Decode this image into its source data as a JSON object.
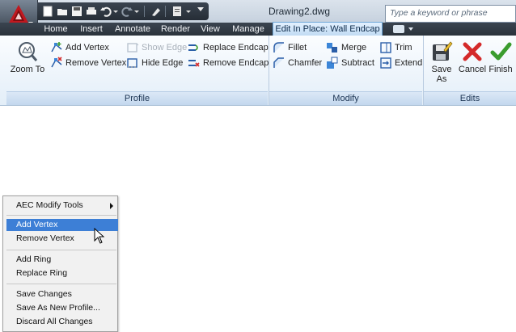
{
  "window": {
    "document_title": "Drawing2.dwg",
    "search_placeholder": "Type a keyword or phrase"
  },
  "tabs": [
    "Home",
    "Insert",
    "Annotate",
    "Render",
    "View",
    "Manage",
    "Edit In Place: Wall Endcap"
  ],
  "active_tab": "Edit In Place: Wall Endcap",
  "ribbon": {
    "profile": {
      "title": "Profile",
      "zoom_to": "Zoom To",
      "add_vertex": "Add Vertex",
      "remove_vertex": "Remove Vertex",
      "show_edge": "Show Edge",
      "hide_edge": "Hide Edge",
      "replace_endcap": "Replace Endcap",
      "remove_endcap": "Remove Endcap"
    },
    "modify": {
      "title": "Modify",
      "fillet": "Fillet",
      "chamfer": "Chamfer",
      "merge": "Merge",
      "subtract": "Subtract",
      "trim": "Trim",
      "extend": "Extend"
    },
    "edits": {
      "title": "Edits",
      "save_as": "Save As",
      "cancel": "Cancel",
      "finish": "Finish"
    }
  },
  "context_menu": {
    "aec_modify_tools": "AEC Modify Tools",
    "add_vertex": "Add Vertex",
    "remove_vertex": "Remove Vertex",
    "add_ring": "Add Ring",
    "replace_ring": "Replace Ring",
    "save_changes": "Save Changes",
    "save_as_new_profile": "Save As New Profile...",
    "discard_all_changes": "Discard All Changes",
    "highlighted_item": "Add Vertex"
  },
  "colors": {
    "title_bar": "#c6d1de",
    "tab_bar": "#2b323b",
    "active_tab": "#bcd8f2",
    "menu_highlight": "#3d7fd6",
    "finish_green": "#3a9c2e",
    "cancel_red": "#d42a2a"
  }
}
